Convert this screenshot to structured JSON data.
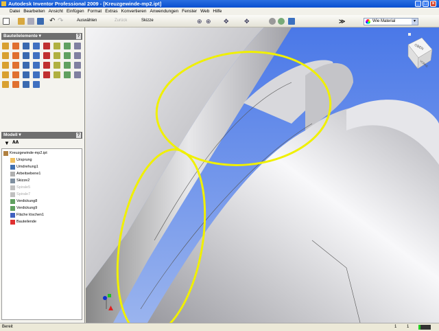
{
  "title": "Autodesk Inventor Professional 2009 - [Kreuzgewinde-mp2.ipt]",
  "menu": [
    "Datei",
    "Bearbeiten",
    "Ansicht",
    "Einfügen",
    "Format",
    "Extras",
    "Konvertieren",
    "Anwendungen",
    "Fenster",
    "Web",
    "Hilfe"
  ],
  "toolbar": {
    "select_label": "Auswählen",
    "back_label": "Zurück",
    "sketch_label": "Skizze",
    "material": "Wie Material"
  },
  "panels": {
    "features_title": "Bauteilelemente",
    "model_title": "Modell"
  },
  "tree": [
    {
      "label": "Kreuzgewinde-mp2.ipt",
      "color": "#b08040",
      "suppressed": false
    },
    {
      "label": "Ursprung",
      "color": "#f0c060",
      "suppressed": false
    },
    {
      "label": "Umdrehung1",
      "color": "#4070b0",
      "suppressed": false
    },
    {
      "label": "Arbeitsebene1",
      "color": "#b0b0b0",
      "suppressed": false
    },
    {
      "label": "Skizze2",
      "color": "#8090a0",
      "suppressed": false
    },
    {
      "label": "Spirale5",
      "color": "#c0c0c0",
      "suppressed": true
    },
    {
      "label": "Spirale7",
      "color": "#c0c0c0",
      "suppressed": true
    },
    {
      "label": "Verdickung8",
      "color": "#60a060",
      "suppressed": false
    },
    {
      "label": "Verdickung9",
      "color": "#60a060",
      "suppressed": false
    },
    {
      "label": "Fläche löschen1",
      "color": "#4060c0",
      "suppressed": false
    },
    {
      "label": "Bauteilende",
      "color": "#e03030",
      "suppressed": false
    }
  ],
  "viewcube": {
    "top": "OBEN",
    "front": "VORNE"
  },
  "status": {
    "text": "Bereit",
    "val1": "1",
    "val2": "1"
  }
}
